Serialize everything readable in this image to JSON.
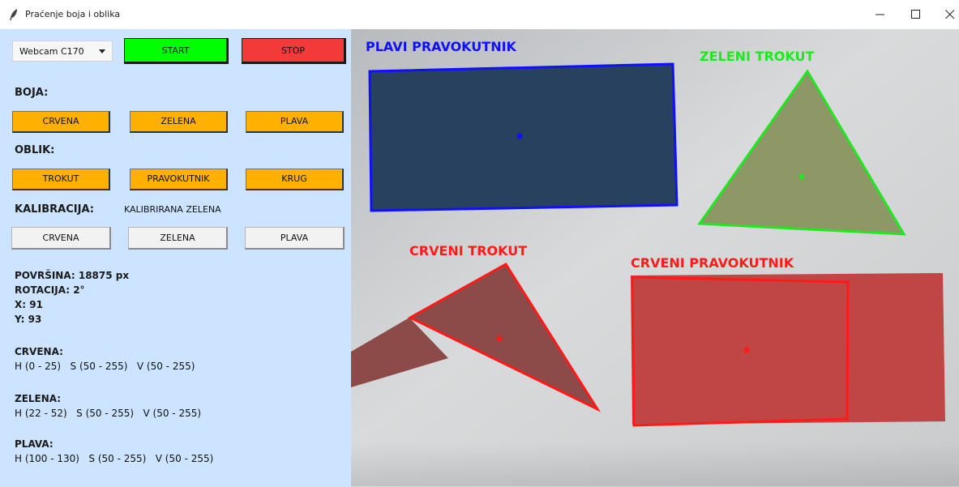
{
  "window": {
    "title": "Praćenje boja i oblika",
    "controls": [
      "minimize",
      "maximize",
      "close"
    ]
  },
  "controls": {
    "camera_select": "Webcam C170",
    "start_label": "START",
    "stop_label": "STOP",
    "start_color": "#00ff00",
    "stop_color": "#f23a3a"
  },
  "color_section": {
    "heading": "BOJA:",
    "buttons": [
      "CRVENA",
      "ZELENA",
      "PLAVA"
    ]
  },
  "shape_section": {
    "heading": "OBLIK:",
    "buttons": [
      "TROKUT",
      "PRAVOKUTNIK",
      "KRUG"
    ]
  },
  "calibration_section": {
    "heading": "KALIBRACIJA:",
    "status": "KALIBRIRANA ZELENA",
    "buttons": [
      "CRVENA",
      "ZELENA",
      "PLAVA"
    ]
  },
  "stats": {
    "area": "POVRŠINA: 18875 px",
    "rotation": "ROTACIJA: 2°",
    "x": "X: 91",
    "y": "Y: 93"
  },
  "hsv_ranges": [
    {
      "name": "CRVENA:",
      "range": "H (0 - 25)   S (50 - 255)   V (50 - 255)"
    },
    {
      "name": "ZELENA:",
      "range": "H (22 - 52)   S (50 - 255)   V (50 - 255)"
    },
    {
      "name": "PLAVA:",
      "range": "H (100 - 130)   S (50 - 255)   V (50 - 255)"
    }
  ],
  "camera_feed": {
    "labels": [
      "PLAVI PRAVOKUTNIK",
      "ZELENI TROKUT",
      "CRVENI TROKUT",
      "CRVENI PRAVOKUTNIK"
    ],
    "colors": {
      "blue": "#1010ff",
      "green": "#22e622",
      "red": "#ff1a1a"
    }
  },
  "colors": {
    "panel_bg": "#cce4ff",
    "orange_button": "#ffb000"
  }
}
